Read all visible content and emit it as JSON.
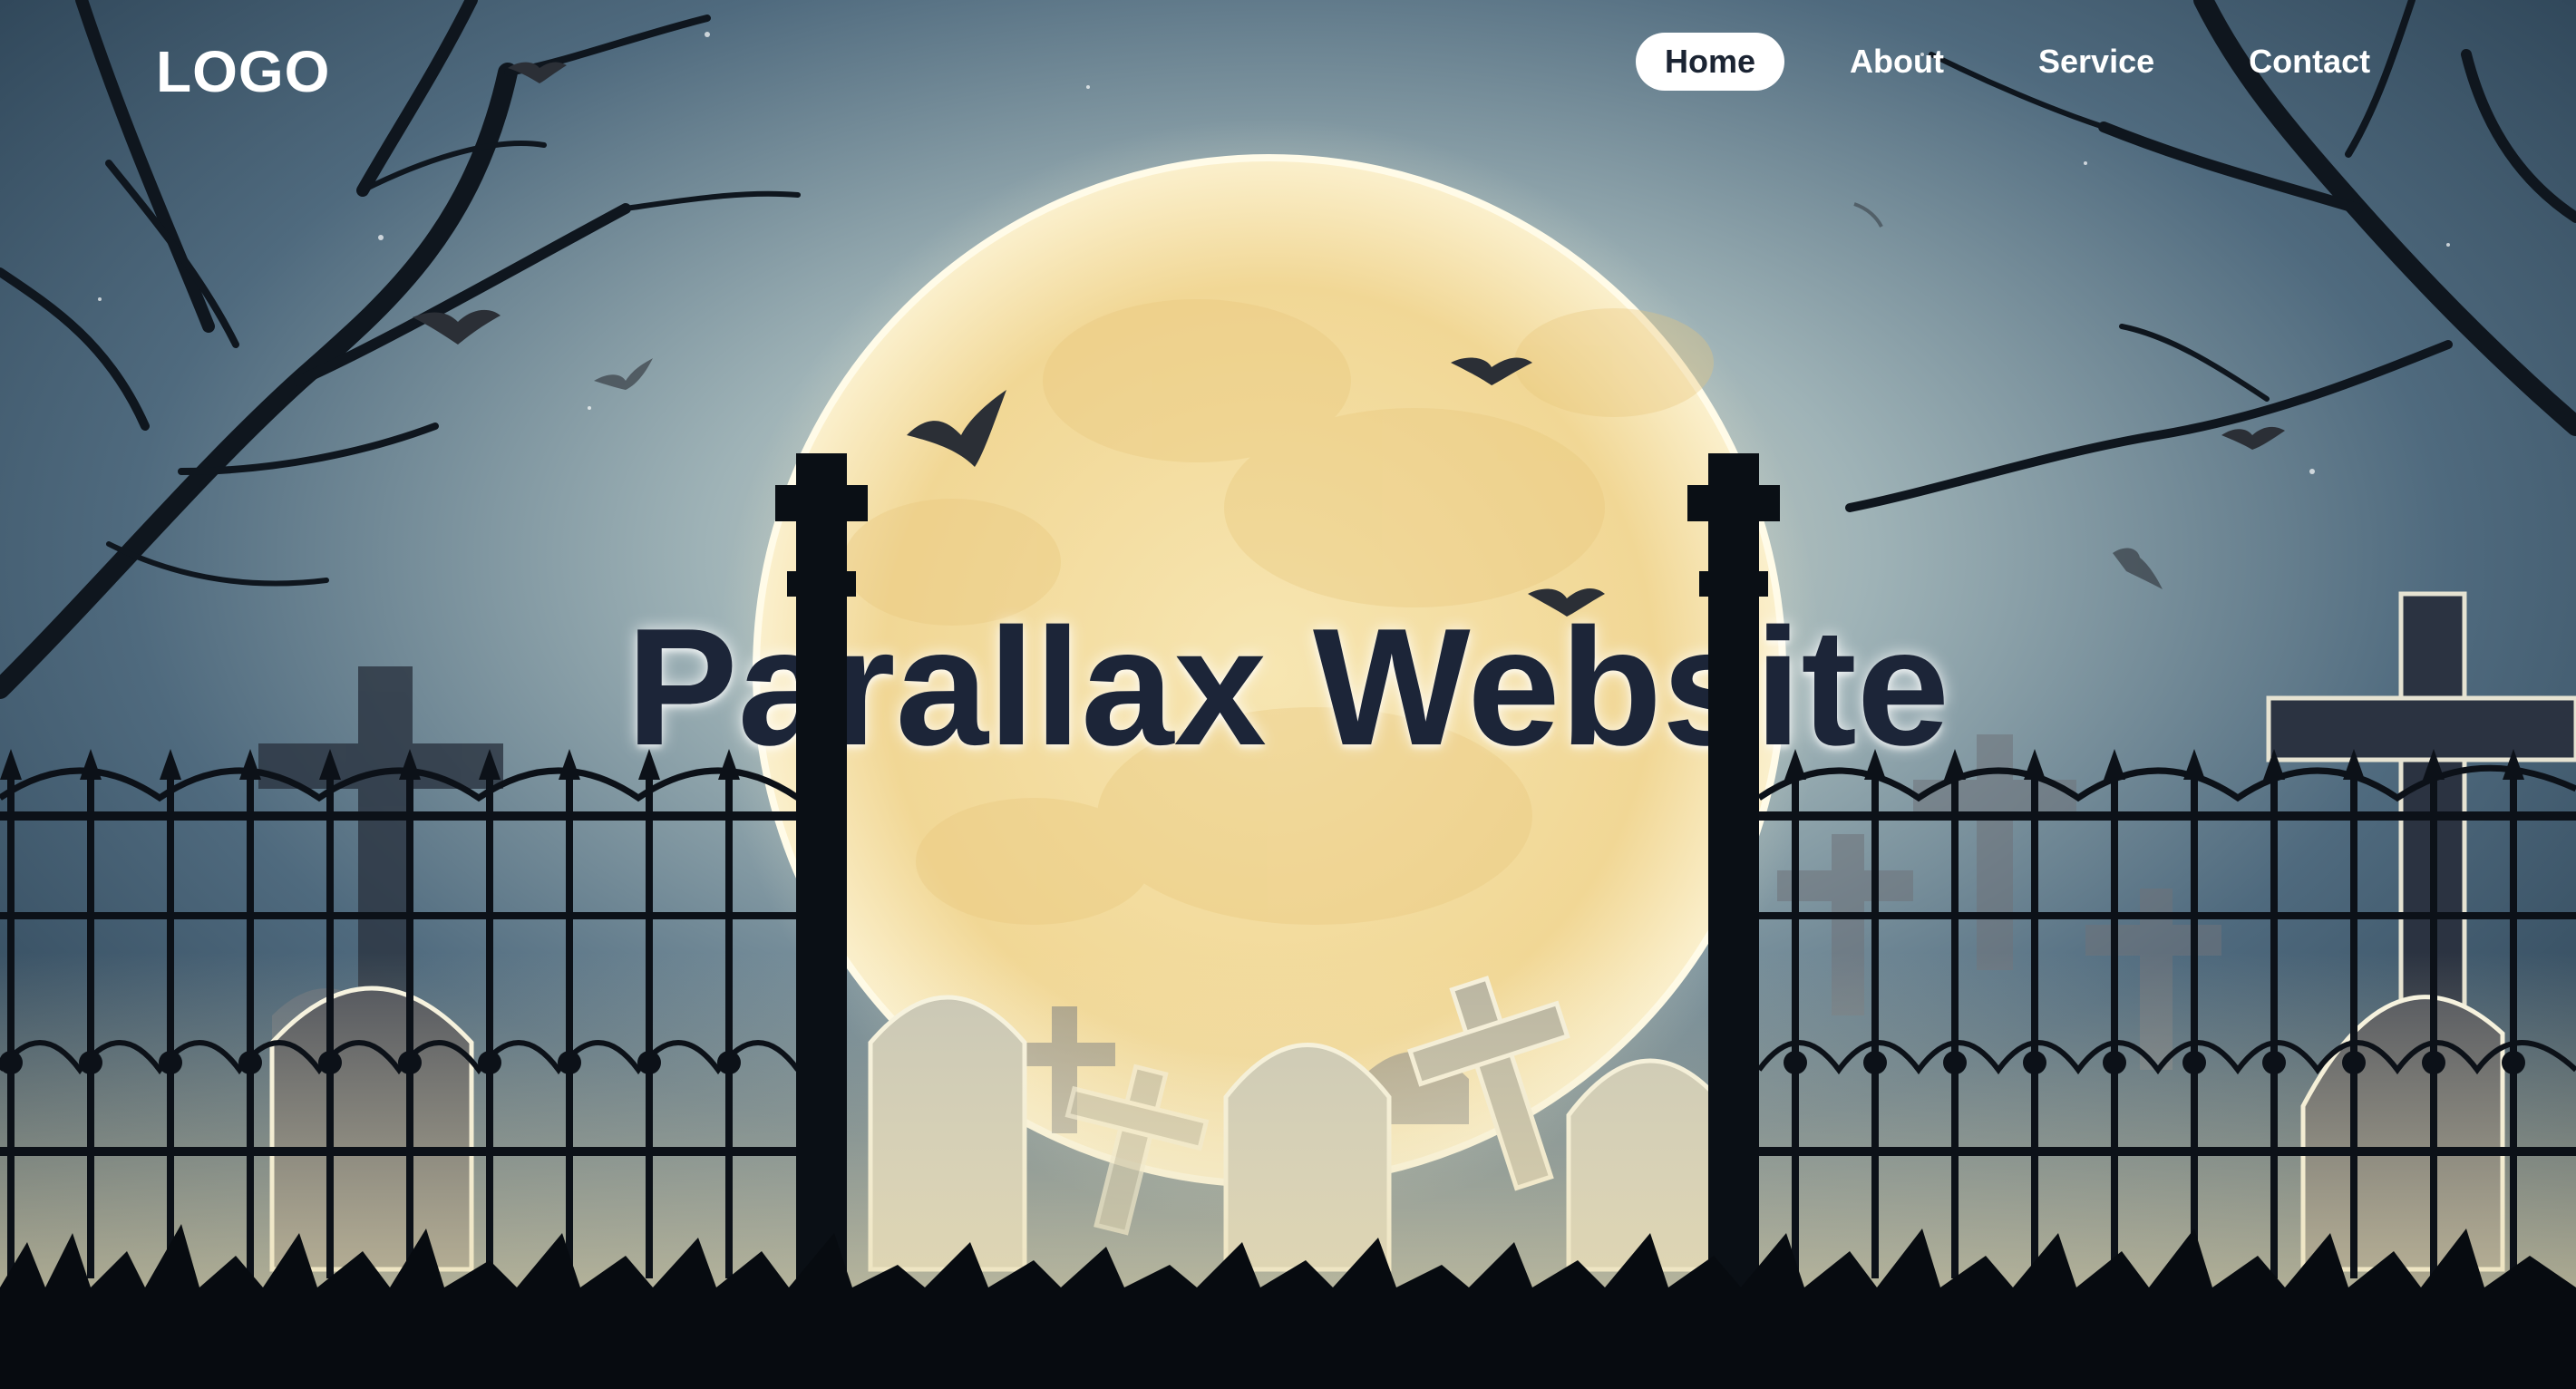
{
  "header": {
    "logo": "LOGO",
    "nav": [
      {
        "label": "Home",
        "active": true
      },
      {
        "label": "About",
        "active": false
      },
      {
        "label": "Service",
        "active": false
      },
      {
        "label": "Contact",
        "active": false
      }
    ]
  },
  "hero": {
    "title": "Parallax Website"
  },
  "colors": {
    "sky_top": "#34506a",
    "sky_mid": "#7f97a4",
    "moon": "#f2dca0",
    "silhouette": "#0c1219",
    "title": "#1c2538"
  }
}
